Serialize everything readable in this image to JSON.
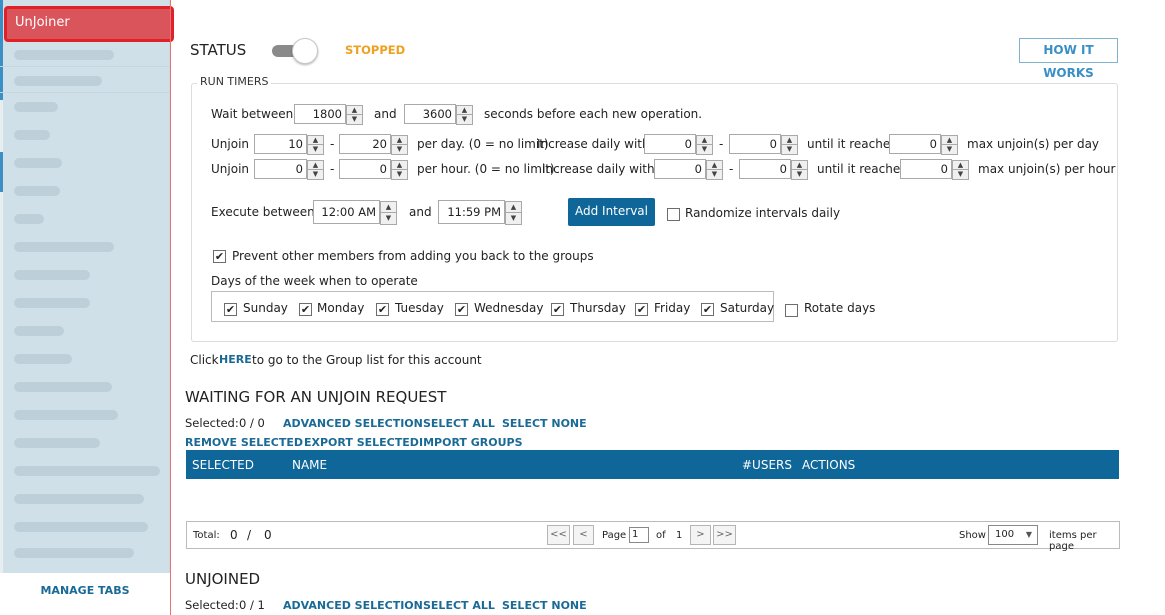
{
  "sidebar": {
    "active_tab": "UnJoiner",
    "manage_tabs": "MANAGE TABS"
  },
  "status": {
    "label": "STATUS",
    "state": "STOPPED",
    "toggle_on": false,
    "state_color": "#f0a020"
  },
  "how_it_works": "HOW IT WORKS",
  "run_timers": {
    "legend": "RUN TIMERS",
    "wait": {
      "label": "Wait between",
      "min": "1800",
      "and": "and",
      "max": "3600",
      "suffix": "seconds before each new operation."
    },
    "per_day": {
      "label": "Unjoin",
      "min": "10",
      "dash": "-",
      "max": "20",
      "desc": "per day. (0 = no limit)",
      "increase_label": "Increase daily with",
      "inc_min": "0",
      "inc_dash": "-",
      "inc_max": "0",
      "until": "until it reaches",
      "reach": "0",
      "max_label": "max unjoin(s) per day"
    },
    "per_hour": {
      "label": "Unjoin",
      "min": "0",
      "dash": "-",
      "max": "0",
      "desc": "per hour. (0 = no limit)",
      "increase_label": "Increase daily with",
      "inc_min": "0",
      "inc_dash": "-",
      "inc_max": "0",
      "until": "until it reaches",
      "reach": "0",
      "max_label": "max unjoin(s) per hour"
    },
    "execute": {
      "label": "Execute between",
      "start": "12:00 AM",
      "and": "and",
      "end": "11:59 PM"
    },
    "add_interval": "Add Interval",
    "randomize": {
      "label": "Randomize intervals daily",
      "checked": false
    },
    "prevent": {
      "label": "Prevent other members from adding you back to the groups",
      "checked": true
    },
    "days_label": "Days of the week when to operate",
    "days": [
      {
        "name": "Sunday",
        "checked": true
      },
      {
        "name": "Monday",
        "checked": true
      },
      {
        "name": "Tuesday",
        "checked": true
      },
      {
        "name": "Wednesday",
        "checked": true
      },
      {
        "name": "Thursday",
        "checked": true
      },
      {
        "name": "Friday",
        "checked": true
      },
      {
        "name": "Saturday",
        "checked": true
      }
    ],
    "rotate": {
      "label": "Rotate days",
      "checked": false
    }
  },
  "group_link": {
    "prefix": "Click",
    "link": "HERE",
    "suffix": "to go to the Group list for this account"
  },
  "waiting": {
    "title": "WAITING FOR AN UNJOIN REQUEST",
    "selected_label": "Selected:",
    "selected_value": "0 / 0",
    "advanced_selection": "ADVANCED SELECTION",
    "select_all": "SELECT ALL",
    "select_none": "SELECT NONE",
    "remove_selected": "REMOVE SELECTED",
    "export_selected": "EXPORT SELECTED",
    "import_groups": "IMPORT GROUPS",
    "columns": [
      "SELECTED",
      "NAME",
      "#USERS",
      "ACTIONS"
    ],
    "pager": {
      "total_label": "Total:",
      "total_value": "0",
      "slash": "/",
      "total_max": "0",
      "first": "<<",
      "prev": "<",
      "page_label": "Page",
      "page_value": "1",
      "of_label": "of",
      "page_count": "1",
      "next": ">",
      "last": ">>",
      "show_label": "Show",
      "per_page": "100",
      "items_label": "items per page"
    }
  },
  "unjoined": {
    "title": "UNJOINED",
    "selected_label": "Selected:",
    "selected_value": "0 / 1",
    "advanced_selection": "ADVANCED SELECTION",
    "select_all": "SELECT ALL",
    "select_none": "SELECT NONE"
  },
  "colors": {
    "accent": "#0e6699",
    "link": "#1a6a96",
    "active_tab": "#d9545b",
    "active_tab_border": "#e22028"
  }
}
